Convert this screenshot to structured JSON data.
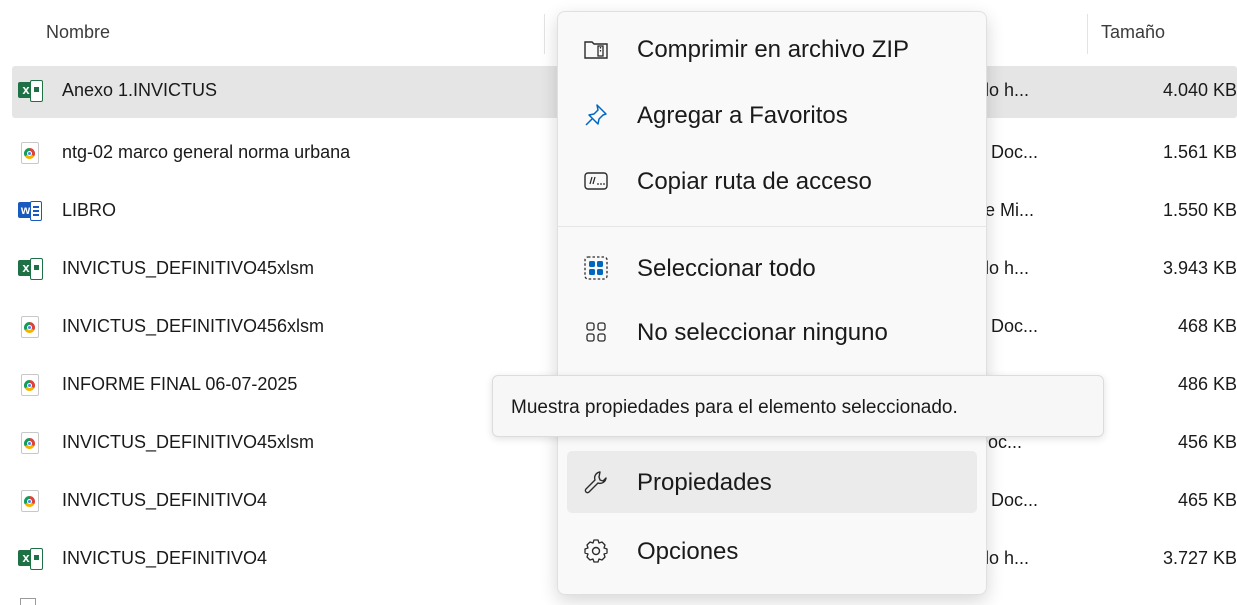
{
  "columns": {
    "name": "Nombre",
    "size": "Tamaño"
  },
  "files": [
    {
      "name": "Anexo 1.INVICTUS",
      "type": "ulo h...",
      "size": "4.040 KB",
      "icon": "excel-file-icon",
      "selected": true
    },
    {
      "name": "ntg-02 marco general norma urbana",
      "type": "F Doc...",
      "size": "1.561 KB",
      "icon": "chrome-pdf-icon",
      "selected": false
    },
    {
      "name": "LIBRO",
      "type": "de Mi...",
      "size": "1.550 KB",
      "icon": "word-file-icon",
      "selected": false
    },
    {
      "name": "INVICTUS_DEFINITIVO45xlsm",
      "type": "ulo h...",
      "size": "3.943 KB",
      "icon": "excel-file-icon",
      "selected": false
    },
    {
      "name": "INVICTUS_DEFINITIVO456xlsm",
      "type": "F Doc...",
      "size": "468 KB",
      "icon": "chrome-pdf-icon",
      "selected": false
    },
    {
      "name": "INFORME FINAL 06-07-2025",
      "type": "",
      "size": "486 KB",
      "icon": "chrome-pdf-icon",
      "selected": false
    },
    {
      "name": "INVICTUS_DEFINITIVO45xlsm",
      "type": "Doc...",
      "size": "456 KB",
      "icon": "chrome-pdf-icon",
      "selected": false
    },
    {
      "name": "INVICTUS_DEFINITIVO4",
      "type": "F Doc...",
      "size": "465 KB",
      "icon": "chrome-pdf-icon",
      "selected": false
    },
    {
      "name": "INVICTUS_DEFINITIVO4",
      "type": "ulo h...",
      "size": "3.727 KB",
      "icon": "excel-file-icon",
      "selected": false
    }
  ],
  "context_menu": {
    "items": [
      {
        "label": "Comprimir en archivo ZIP",
        "icon": "zip-folder-icon"
      },
      {
        "label": "Agregar a Favoritos",
        "icon": "pin-icon"
      },
      {
        "label": "Copiar ruta de acceso",
        "icon": "copy-path-icon"
      },
      {
        "label": "Seleccionar todo",
        "icon": "select-all-icon"
      },
      {
        "label": "No seleccionar ninguno",
        "icon": "select-none-icon"
      },
      {
        "label": "Propiedades",
        "icon": "wrench-icon",
        "hovered": true
      },
      {
        "label": "Opciones",
        "icon": "gear-icon"
      }
    ]
  },
  "tooltip": {
    "text": "Muestra propiedades para el elemento seleccionado."
  },
  "colors": {
    "selected_row": "#e5e5e5",
    "menu_bg": "#f9f9f9",
    "accent": "#0067c0"
  }
}
